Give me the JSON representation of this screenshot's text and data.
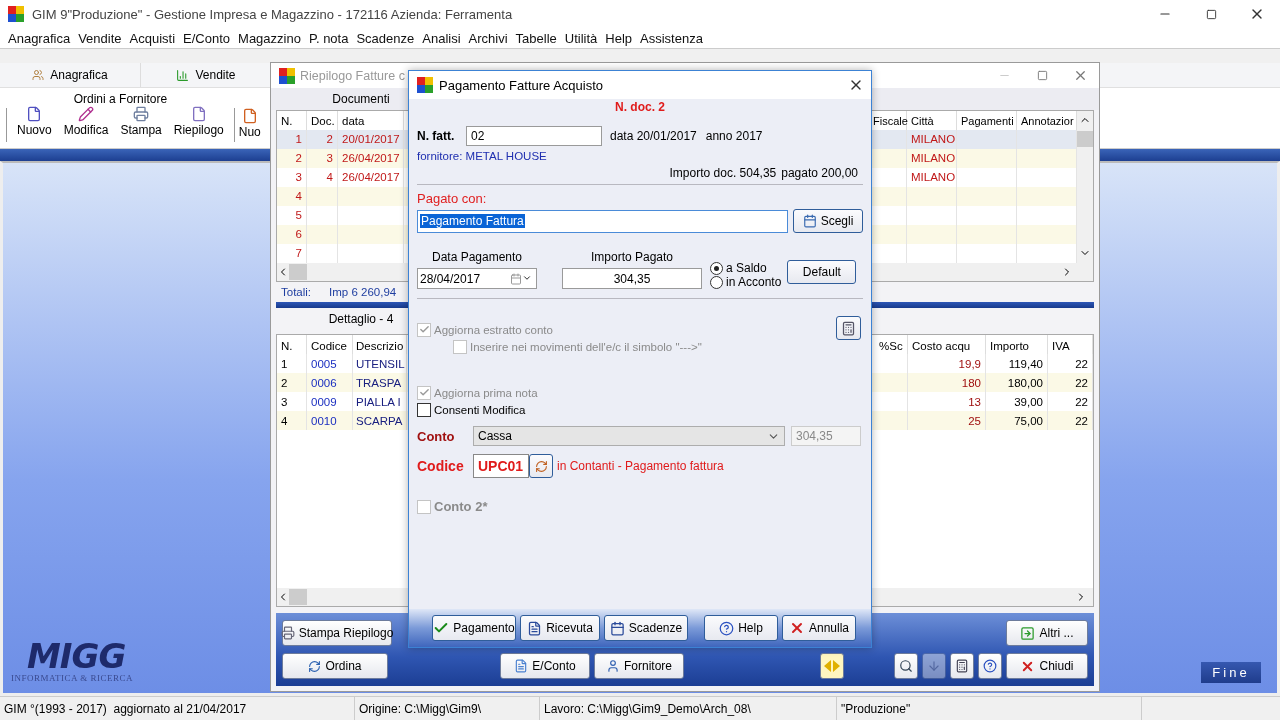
{
  "window": {
    "title": "GIM 9\"Produzione\" - Gestione Impresa e Magazzino - 172116 Azienda: Ferramenta"
  },
  "menu": [
    "Anagrafica",
    "Vendite",
    "Acquisti",
    "E/Conto",
    "Magazzino",
    "P. nota",
    "Scadenze",
    "Analisi",
    "Archivi",
    "Tabelle",
    "Utilità",
    "Help",
    "Assistenza"
  ],
  "toolbar_tabs": [
    "Anagrafica",
    "Vendite"
  ],
  "ribbon": {
    "group": "Ordini a Fornitore",
    "buttons": [
      "Nuovo",
      "Modifica",
      "Stampa",
      "Riepilogo",
      "Nuo"
    ]
  },
  "summary_window": {
    "title": "Riepilogo Fatture c",
    "section": "Documenti",
    "columns_left": [
      "N.",
      "Doc.",
      "data"
    ],
    "columns_right": [
      "Fiscale",
      "Città",
      "Pagamenti",
      "Annotazior"
    ],
    "rows": [
      {
        "n": "1",
        "doc": "2",
        "date": "20/01/2017",
        "city": "MILANO",
        "selected": true
      },
      {
        "n": "2",
        "doc": "3",
        "date": "26/04/2017",
        "city": "MILANO",
        "selected": false
      },
      {
        "n": "3",
        "doc": "4",
        "date": "26/04/2017",
        "city": "MILANO",
        "selected": false
      },
      {
        "n": "4",
        "selected": false
      },
      {
        "n": "5",
        "selected": false
      },
      {
        "n": "6",
        "selected": false
      },
      {
        "n": "7",
        "selected": false
      }
    ],
    "totals_label": "Totali:",
    "totals_value": "Imp 6 260,94",
    "detail_title": "Dettaglio - 4",
    "detail_columns_left": [
      "N.",
      "Codice",
      "Descrizio"
    ],
    "detail_columns_right": [
      "%Sc",
      "Costo acqu",
      "Importo",
      "IVA"
    ],
    "detail_rows": [
      {
        "n": "1",
        "code": "0005",
        "description": "UTENSIL",
        "cost": "19,9",
        "amount": "119,40",
        "vat": "22"
      },
      {
        "n": "2",
        "code": "0006",
        "description": "TRASPA",
        "cost": "180",
        "amount": "180,00",
        "vat": "22"
      },
      {
        "n": "3",
        "code": "0009",
        "description": "PIALLA I",
        "cost": "13",
        "amount": "39,00",
        "vat": "22"
      },
      {
        "n": "4",
        "code": "0010",
        "description": "SCARPA",
        "cost": "25",
        "amount": "75,00",
        "vat": "22"
      }
    ],
    "print_button": "Stampa Riepilogo",
    "more_button": "Altri ...",
    "sort_button": "Ordina",
    "statement_button": "E/Conto",
    "supplier_button": "Fornitore",
    "close_button": "Chiudi",
    "icon_buttons": [
      {
        "disabled": false
      },
      {
        "disabled": true
      },
      {
        "disabled": false
      },
      {
        "disabled": false
      }
    ]
  },
  "dialog": {
    "title": "Pagamento Fatture Acquisto",
    "doc_number": "N. doc. 2",
    "invoice_label": "N. fatt.",
    "invoice_value": "02",
    "invoice_date": "data 20/01/2017",
    "invoice_year": "anno 2017",
    "supplier": "fornitore: METAL HOUSE",
    "amount_text": "Importo doc. 504,35",
    "paid_text": "pagato 200,00",
    "paid_with_label": "Pagato con:",
    "paid_with_value": "Pagamento Fattura",
    "choose_button": "Scegli",
    "date_label": "Data Pagamento",
    "date_value": "28/04/2017",
    "amount_label": "Importo Pagato",
    "amount_value": "304,35",
    "payment_modes": [
      {
        "label": "a Saldo",
        "selected": true
      },
      {
        "label": "in Acconto",
        "selected": false
      }
    ],
    "default_button": "Default",
    "statement_options": [
      {
        "label": "Aggiorna estratto conto",
        "checked": true,
        "disabled": true,
        "children": [
          {
            "label": "Inserire nei movimenti dell'e/c il simbolo \"--->\"",
            "checked": false,
            "disabled": true
          }
        ]
      }
    ],
    "ledger_options": [
      {
        "label": "Aggiorna prima nota",
        "checked": true,
        "disabled": true
      },
      {
        "label": "Consenti Modifica",
        "checked": false,
        "disabled": false
      }
    ],
    "account_label": "Conto",
    "account_value": "Cassa",
    "account_amount": "304,35",
    "code_label": "Codice",
    "code_value": "UPC01",
    "code_description": "in Contanti - Pagamento fattura",
    "second_account": {
      "label": "Conto 2*",
      "checked": false,
      "disabled": true
    },
    "buttons": [
      "Pagamento",
      "Ricevuta",
      "Scadenze",
      "Help",
      "Annulla"
    ]
  },
  "desktop": {
    "logo_name": "MIGG",
    "logo_tagline": "INFORMATICA & RICERCA",
    "exit_button": "Fine"
  },
  "status_bar": [
    "GIM °(1993 - 2017)  aggiornato al 21/04/2017",
    "Origine: C:\\Migg\\Gim9\\",
    "Lavoro: C:\\Migg\\Gim9_Demo\\Arch_08\\",
    "\"Produzione\""
  ]
}
